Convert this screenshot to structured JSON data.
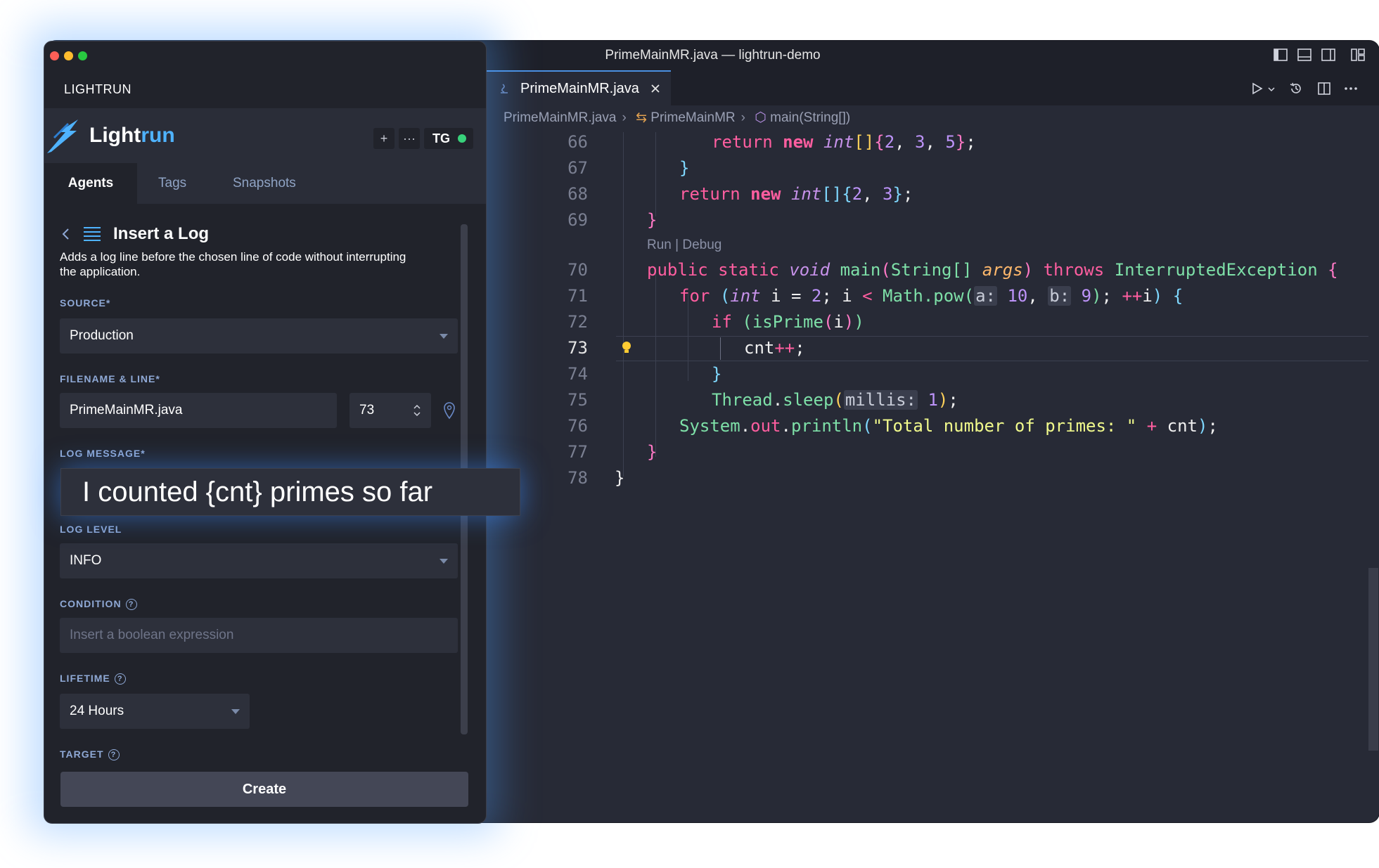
{
  "editor": {
    "window_title": "PrimeMainMR.java — lightrun-demo",
    "tab_label": "PrimeMainMR.java",
    "breadcrumb": [
      "PrimeMainMR.java",
      "PrimeMainMR",
      "main(String[])"
    ],
    "codelens": "Run | Debug",
    "line_numbers": [
      "66",
      "67",
      "68",
      "69",
      "70",
      "71",
      "72",
      "73",
      "74",
      "75",
      "76",
      "77",
      "78"
    ],
    "active_line": "73",
    "code": {
      "l66_return": "return",
      "l66_new": "new",
      "l66_int": "int",
      "l66_rest_a": "[]",
      "l66_brace_open": "{",
      "l66_n1": "2",
      "l66_n2": "3",
      "l66_n3": "5",
      "l66_brace_close": "}",
      "l66_semi": ";",
      "l67": "}",
      "l68_return": "return",
      "l68_new": "new",
      "l68_int": "int",
      "l68_rest_a": "[]",
      "l68_brace_open": "{",
      "l68_n1": "2",
      "l68_n2": "3",
      "l68_brace_close": "}",
      "l68_semi": ";",
      "l69": "}",
      "l70_public": "public",
      "l70_static": "static",
      "l70_void": "void",
      "l70_main": "main",
      "l70_paren_open": "(",
      "l70_string": "String[]",
      "l70_args": "args",
      "l70_paren_close": ")",
      "l70_throws": "throws",
      "l70_exc": "InterruptedException",
      "l70_brace": "{",
      "l71_for": "for",
      "l71_paren_open": "(",
      "l71_int": "int",
      "l71_a": " i = ",
      "l71_2": "2",
      "l71_b": "; i ",
      "l71_lt": "<",
      "l71_math": " Math.",
      "l71_pow": "pow",
      "l71_pp": "(",
      "l71_hint_a": "a:",
      "l71_10": "10",
      "l71_comma": ", ",
      "l71_hint_b": "b:",
      "l71_9": "9",
      "l71_pc": ")",
      "l71_c": "; ",
      "l71_inc": "++",
      "l71_i": "i",
      "l71_close": ")",
      "l71_brace": "{",
      "l72_if": "if",
      "l72_open": "(",
      "l72_fn": "isPrime",
      "l72_inner_open": "(",
      "l72_i": "i",
      "l72_inner_close": ")",
      "l72_close": ")",
      "l73_cnt": "cnt",
      "l73_inc": "++",
      "l73_semi": ";",
      "l74": "}",
      "l75_thread": "Thread",
      "l75_dot": ".",
      "l75_sleep": "sleep",
      "l75_open": "(",
      "l75_hint": "millis:",
      "l75_1": "1",
      "l75_close": ")",
      "l75_semi": ";",
      "l76_system": "System",
      "l76_dot1": ".",
      "l76_out": "out",
      "l76_dot2": ".",
      "l76_println": "println",
      "l76_open": "(",
      "l76_str": "\"Total number of primes: \"",
      "l76_plus": "+",
      "l76_cnt": "cnt",
      "l76_close": ")",
      "l76_semi": ";",
      "l77": "}",
      "l78": "}"
    }
  },
  "panel": {
    "header_label": "LIGHTRUN",
    "brand_light": "Light",
    "brand_run": "run",
    "add_button": "+",
    "more_button": "···",
    "user_initials": "TG",
    "tabs": [
      "Agents",
      "Tags",
      "Snapshots"
    ],
    "form_title": "Insert a Log",
    "form_description": "Adds a log line before the chosen line of code without interrupting the application.",
    "source_label": "SOURCE*",
    "source_value": "Production",
    "filename_label": "FILENAME & LINE*",
    "filename_value": "PrimeMainMR.java",
    "line_value": "73",
    "log_message_label": "LOG MESSAGE*",
    "log_message_value": "I counted {cnt} primes so far",
    "log_level_label": "LOG LEVEL",
    "log_level_value": "INFO",
    "condition_label": "CONDITION",
    "condition_placeholder": "Insert a boolean expression",
    "lifetime_label": "LIFETIME",
    "lifetime_value": "24 Hours",
    "target_label": "TARGET",
    "create_button": "Create",
    "help_glyph": "?"
  },
  "colors": {
    "accent": "#4fb3ff",
    "status_ok": "#38d27b",
    "editor_bg": "#272a36",
    "panel_bg": "#21232b"
  }
}
